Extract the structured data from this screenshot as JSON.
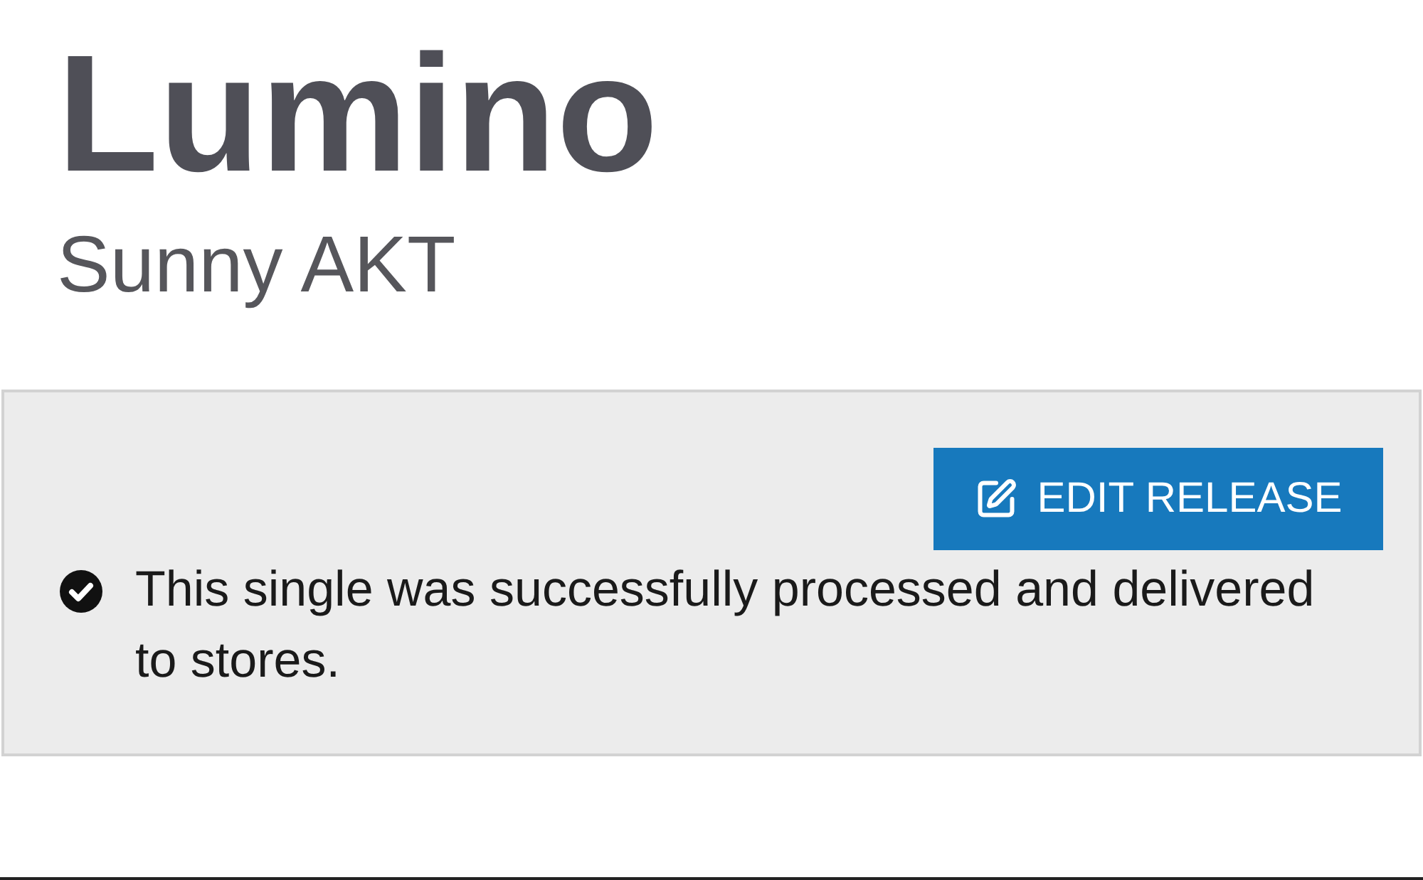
{
  "release": {
    "title": "Lumino",
    "artist": "Sunny AKT"
  },
  "status_panel": {
    "edit_button": {
      "label": "EDIT RELEASE"
    },
    "message": "This single was successfully processed and delivered to stores."
  }
}
